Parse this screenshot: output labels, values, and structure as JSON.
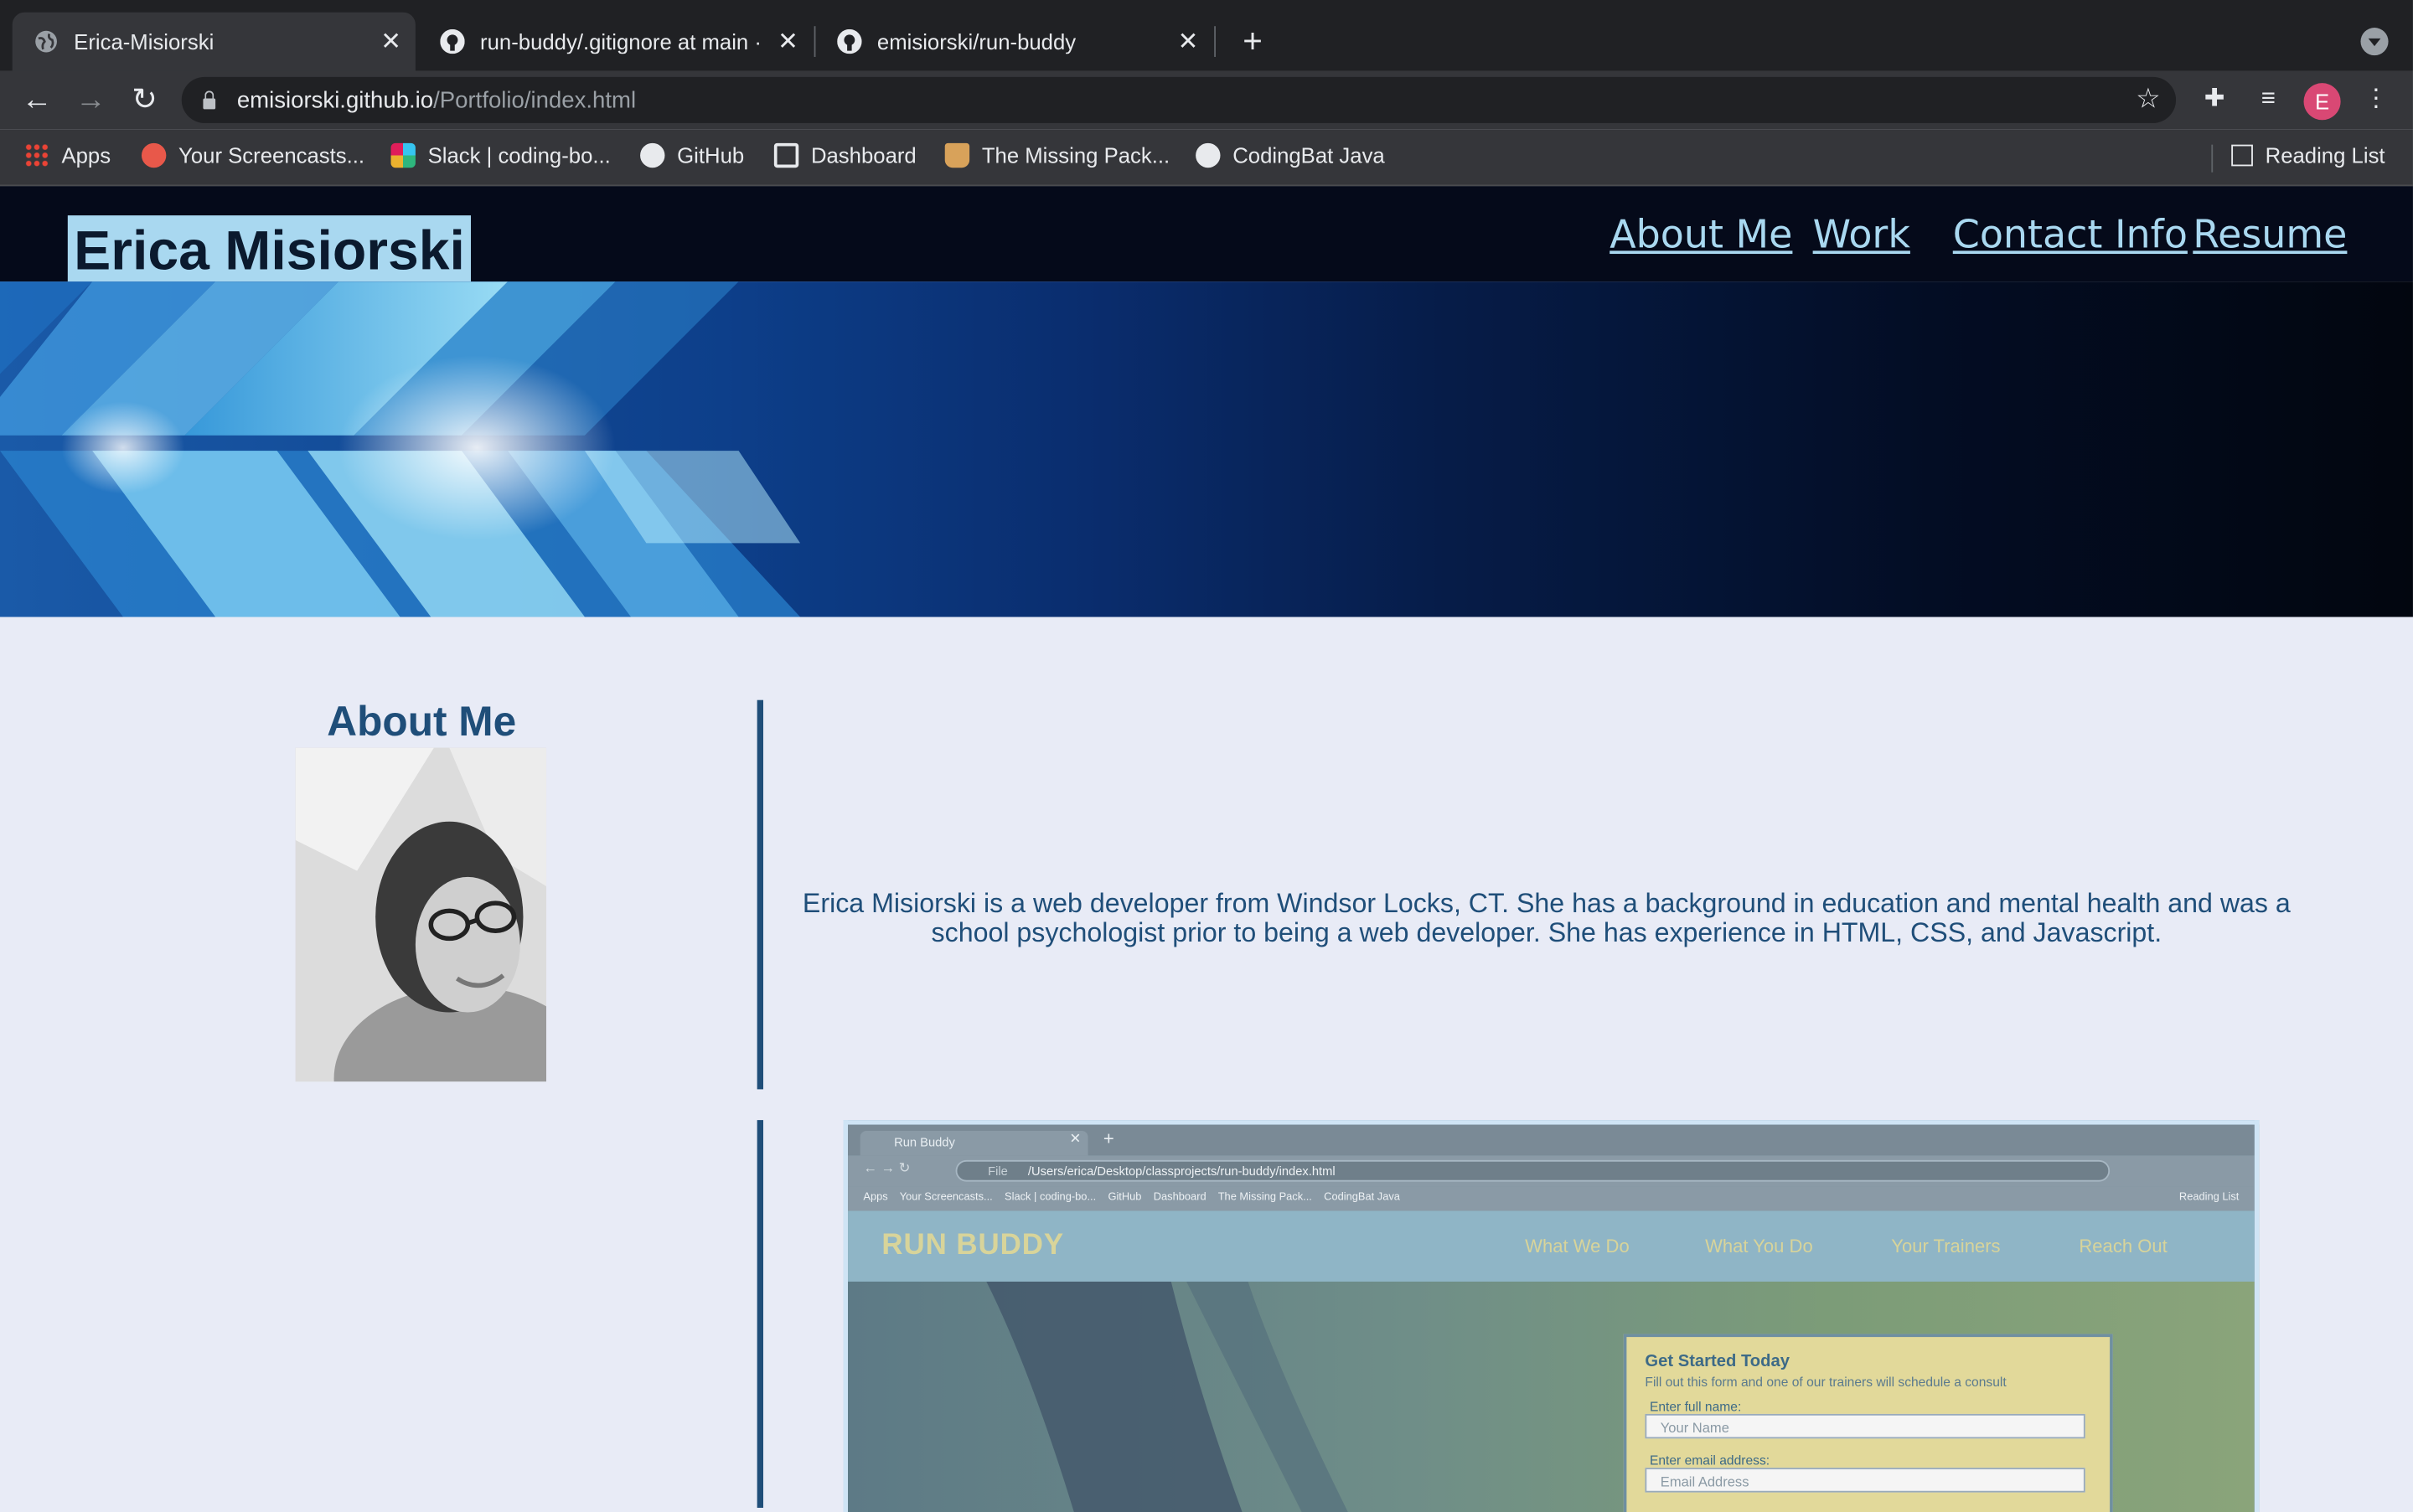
{
  "browser": {
    "tabs": [
      {
        "title": "Erica-Misiorski",
        "active": true
      },
      {
        "title": "run-buddy/.gitignore at main · ",
        "active": false
      },
      {
        "title": "emisiorski/run-buddy",
        "active": false
      }
    ],
    "url_host": "emisiorski.github.io",
    "url_path": "/Portfolio/index.html",
    "profile_initial": "E",
    "bookmarks": [
      "Apps",
      "Your Screencasts...",
      "Slack | coding-bo...",
      "GitHub",
      "Dashboard",
      "The Missing Pack...",
      "CodingBat Java"
    ],
    "reading_list": "Reading List"
  },
  "site": {
    "title": "Erica Misiorski",
    "nav": [
      "About Me",
      "Work",
      "Contact Info",
      "Resume"
    ],
    "about_heading": "About Me",
    "bio": "Erica Misiorski is a web developer from Windsor Locks, CT. She has a background in education and mental health and was a school psychologist prior to being a web developer. She has experience in HTML, CSS, and Javascript."
  },
  "work_screenshot": {
    "tab_title": "Run Buddy",
    "url": "/Users/erica/Desktop/classprojects/run-buddy/index.html",
    "url_prefix": "File",
    "bookmarks": "Apps    Your Screencasts...    Slack | coding-bo...    GitHub    Dashboard    The Missing Pack...    CodingBat Java",
    "reading_list": "Reading List",
    "logo": "RUN BUDDY",
    "nav": [
      "What We Do",
      "What You Do",
      "Your Trainers",
      "Reach Out"
    ],
    "form_heading": "Get Started Today",
    "form_sub": "Fill out this form and one of our trainers will schedule a consult",
    "name_label": "Enter full name:",
    "name_placeholder": "Your Name",
    "email_label": "Enter email address:",
    "email_placeholder": "Email Address"
  },
  "colors": {
    "header_bg": "#050a1a",
    "title_bg": "#a9d8f0",
    "accent": "#1f4e79",
    "page_bg": "#e8ebf6"
  }
}
